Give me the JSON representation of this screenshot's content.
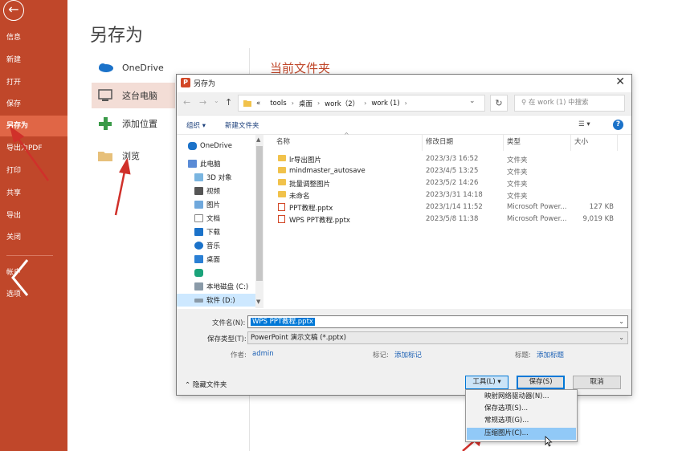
{
  "sidebar": {
    "back_icon": "back-arrow-icon",
    "items": [
      {
        "label": "信息"
      },
      {
        "label": "新建"
      },
      {
        "label": "打开"
      },
      {
        "label": "保存"
      },
      {
        "label": "另存为"
      },
      {
        "label": "导出为PDF"
      },
      {
        "label": "打印"
      },
      {
        "label": "共享"
      },
      {
        "label": "导出"
      },
      {
        "label": "关闭"
      },
      {
        "label": "帐户"
      },
      {
        "label": "选项"
      }
    ],
    "active": "另存为"
  },
  "page": {
    "title": "另存为",
    "locations": [
      {
        "label": "OneDrive",
        "icon": "cloud-icon"
      },
      {
        "label": "这台电脑",
        "icon": "computer-icon"
      },
      {
        "label": "添加位置",
        "icon": "plus-icon"
      },
      {
        "label": "浏览",
        "icon": "folder-icon"
      }
    ],
    "current_folder_heading": "当前文件夹"
  },
  "dialog": {
    "title": "另存为",
    "address": {
      "prefix": "«",
      "crumbs": [
        "tools",
        "桌面",
        "work（2）",
        "work (1)"
      ]
    },
    "search_placeholder": "在 work (1) 中搜索",
    "toolbar": {
      "organize": "组织 ▾",
      "new_folder": "新建文件夹",
      "view": "☰ ▾",
      "help": "?"
    },
    "tree": [
      {
        "label": "OneDrive",
        "icon": "cloud-icon"
      },
      {
        "label": "此电脑",
        "icon": "computer-icon"
      },
      {
        "label": "3D 对象",
        "icon": "cube-icon"
      },
      {
        "label": "视频",
        "icon": "video-icon"
      },
      {
        "label": "图片",
        "icon": "picture-icon"
      },
      {
        "label": "文档",
        "icon": "document-icon"
      },
      {
        "label": "下载",
        "icon": "download-icon"
      },
      {
        "label": "音乐",
        "icon": "music-icon"
      },
      {
        "label": "桌面",
        "icon": "desktop-icon"
      },
      {
        "label": "",
        "icon": "app-icon"
      },
      {
        "label": "本地磁盘 (C:)",
        "icon": "drive-icon"
      },
      {
        "label": "软件 (D:)",
        "icon": "drive-icon"
      }
    ],
    "columns": {
      "name": "名称",
      "date": "修改日期",
      "type": "类型",
      "size": "大小"
    },
    "files": [
      {
        "name": "lr导出图片",
        "date": "2023/3/3 16:52",
        "type": "文件夹",
        "size": "",
        "kind": "folder"
      },
      {
        "name": "mindmaster_autosave",
        "date": "2023/4/5 13:25",
        "type": "文件夹",
        "size": "",
        "kind": "folder"
      },
      {
        "name": "批量调整图片",
        "date": "2023/5/2 14:26",
        "type": "文件夹",
        "size": "",
        "kind": "folder"
      },
      {
        "name": "未命名",
        "date": "2023/3/31 14:18",
        "type": "文件夹",
        "size": "",
        "kind": "folder"
      },
      {
        "name": "PPT教程.pptx",
        "date": "2023/1/14 11:52",
        "type": "Microsoft Power...",
        "size": "127 KB",
        "kind": "pptx"
      },
      {
        "name": "WPS PPT教程.pptx",
        "date": "2023/5/8 11:38",
        "type": "Microsoft Power...",
        "size": "9,019 KB",
        "kind": "pptx"
      }
    ],
    "filename_label": "文件名(N):",
    "filename_value": "WPS PPT教程.pptx",
    "savetype_label": "保存类型(T):",
    "savetype_value": "PowerPoint 演示文稿 (*.pptx)",
    "author_label": "作者:",
    "author_value": "admin",
    "tags_label": "标记:",
    "tags_value": "添加标记",
    "title_label": "标题:",
    "title_value": "添加标题",
    "hide_folders": "隐藏文件夹",
    "tools_button": "工具(L)",
    "save_button": "保存(S)",
    "cancel_button": "取消"
  },
  "tools_menu": [
    {
      "label": "映射网络驱动器(N)..."
    },
    {
      "label": "保存选项(S)..."
    },
    {
      "label": "常规选项(G)..."
    },
    {
      "label": "压缩图片(C)..."
    }
  ],
  "colors": {
    "accent": "#c0472a",
    "selection": "#0078d7",
    "highlight": "#91c9f7",
    "arrow": "#d0302a"
  }
}
